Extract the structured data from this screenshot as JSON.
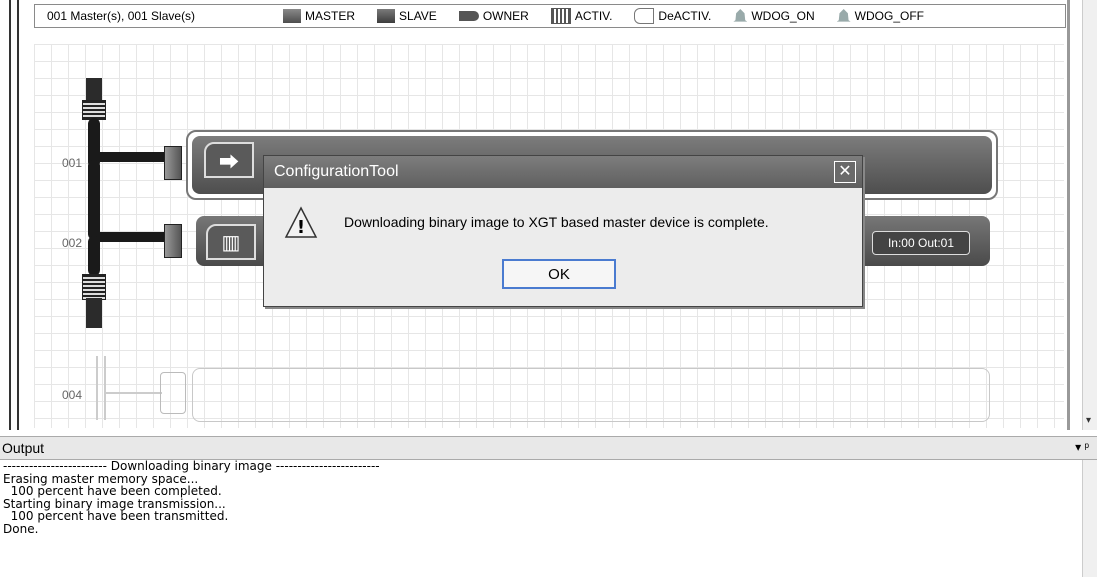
{
  "legend": {
    "count_text": "001 Master(s), 001 Slave(s)",
    "items": [
      {
        "label": "MASTER",
        "icon": "master-swatch-icon"
      },
      {
        "label": "SLAVE",
        "icon": "slave-swatch-icon"
      },
      {
        "label": "OWNER",
        "icon": "owner-connector-icon"
      },
      {
        "label": "ACTIV.",
        "icon": "active-swatch-icon"
      },
      {
        "label": "DeACTIV.",
        "icon": "deactive-swatch-icon"
      },
      {
        "label": "WDOG_ON",
        "icon": "bell-icon"
      },
      {
        "label": "WDOG_OFF",
        "icon": "bell-icon"
      }
    ]
  },
  "network": {
    "address_1": "001",
    "address_2": "002",
    "address_4": "004",
    "slave_io": "In:00 Out:01"
  },
  "dialog": {
    "title": "ConfigurationTool",
    "close_symbol": "✕",
    "message": "Downloading binary image to XGT based master device is complete.",
    "ok_label": "OK",
    "warn_symbol": "!"
  },
  "output": {
    "title": "Output",
    "tools": "▾ ᵖ",
    "lines": [
      "------------------------ Downloading binary image ------------------------",
      "Erasing master memory space...",
      "  100 percent have been completed.",
      "Starting binary image transmission...",
      "  100 percent have been transmitted.",
      "Done."
    ]
  }
}
